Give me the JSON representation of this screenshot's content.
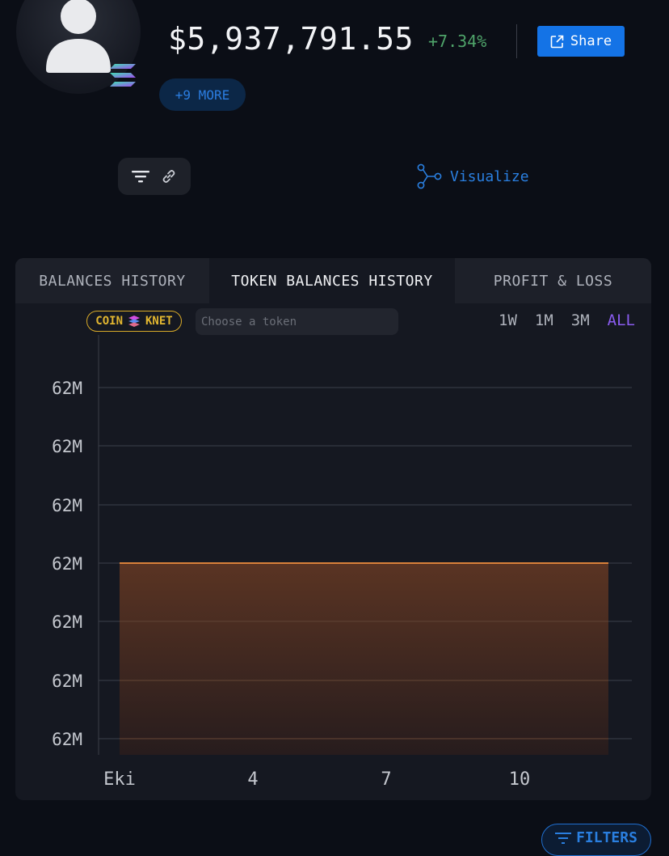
{
  "profile": {
    "value": "$5,937,791.55",
    "change": "+7.34%",
    "share_label": "Share",
    "more_label": "+9 MORE"
  },
  "toolbar": {
    "visualize_label": "Visualize"
  },
  "tabs": [
    {
      "label": "BALANCES HISTORY",
      "active": false
    },
    {
      "label": "TOKEN BALANCES HISTORY",
      "active": true
    },
    {
      "label": "PROFIT & LOSS",
      "active": false
    }
  ],
  "token_filter": {
    "coin_label": "COIN",
    "token_symbol": "KNET",
    "placeholder": "Choose a token"
  },
  "ranges": [
    "1W",
    "1M",
    "3M",
    "ALL"
  ],
  "selected_range": "ALL",
  "filters_label": "FILTERS",
  "colors": {
    "accent": "#1473e6",
    "positive": "#4fa46a",
    "area_line": "#d9813a",
    "range_selected": "#8a5cf0",
    "coin_badge": "#e2b630"
  },
  "chart_data": {
    "type": "area",
    "x_tick_labels": [
      "Eki",
      "4",
      "7",
      "10"
    ],
    "y_tick_labels": [
      "62M",
      "62M",
      "62M",
      "62M",
      "62M",
      "62M",
      "62M"
    ],
    "series": [
      {
        "values": [
          62,
          62,
          62,
          62
        ]
      }
    ],
    "grid": true
  }
}
